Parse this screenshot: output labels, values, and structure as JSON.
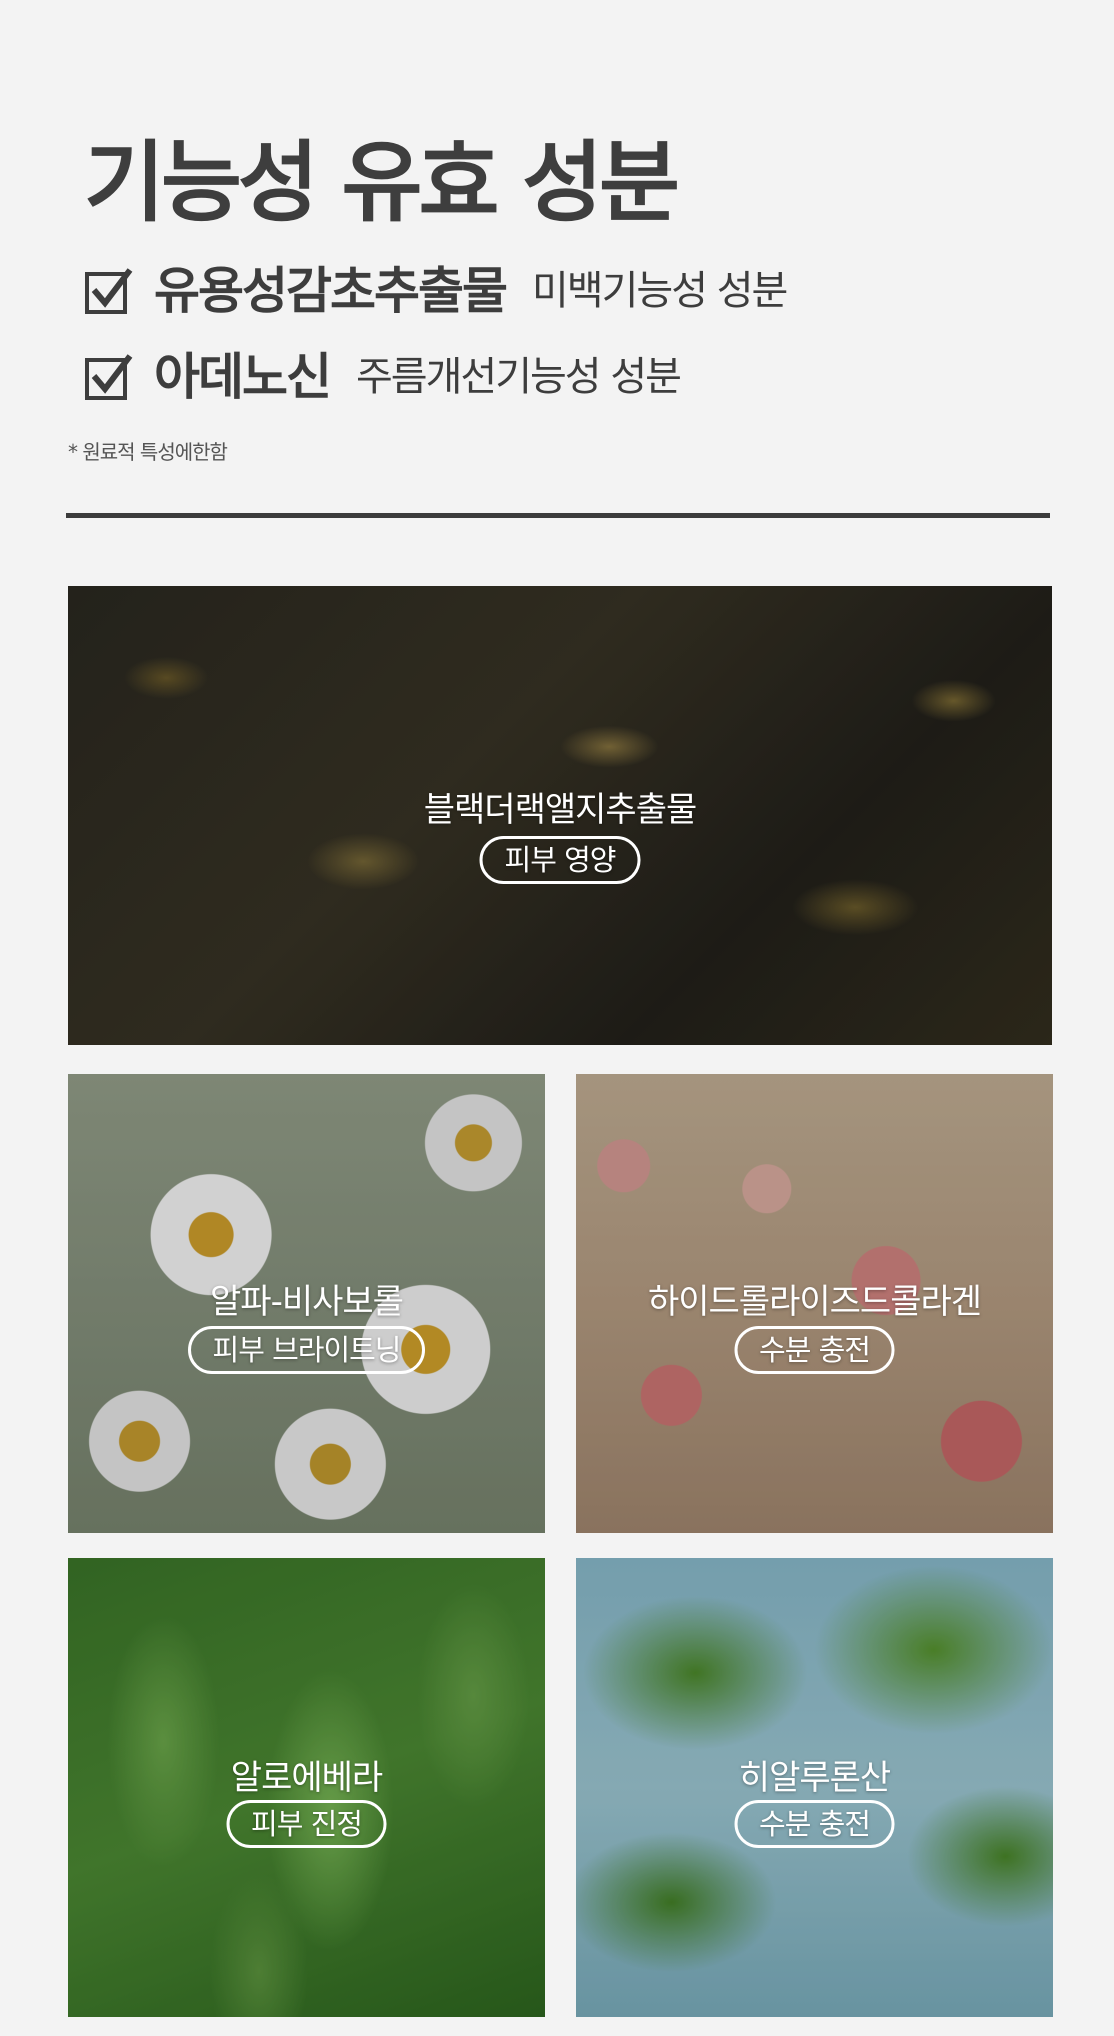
{
  "header": {
    "title": "기능성 유효 성분"
  },
  "functional_ingredients": [
    {
      "name": "유용성감초추출물",
      "description": "미백기능성 성분"
    },
    {
      "name": "아데노신",
      "description": "주름개선기능성 성분"
    }
  ],
  "note": "* 원료적 특성에한함",
  "tiles": [
    {
      "name": "블랙더랙앨지추출물",
      "benefit": "피부 영양"
    },
    {
      "name": "알파-비사보롤",
      "benefit": "피부 브라이트닝"
    },
    {
      "name": "하이드롤라이즈드콜라겐",
      "benefit": "수분 충전"
    },
    {
      "name": "알로에베라",
      "benefit": "피부 진정"
    },
    {
      "name": "히알루론산",
      "benefit": "수분 충전"
    }
  ],
  "icons": {
    "checkbox": "checked-box-icon"
  }
}
